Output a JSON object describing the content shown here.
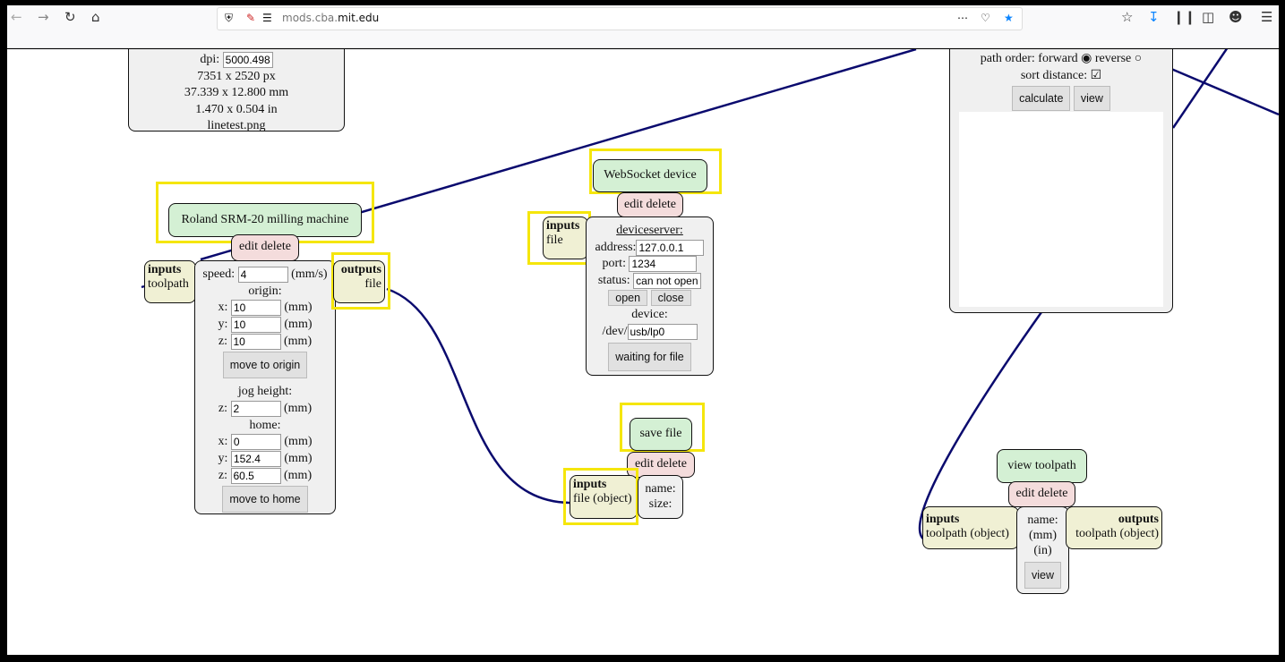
{
  "browser": {
    "url_prefix": "mods.cba.",
    "url_domain": "mit.edu",
    "icons": [
      "back-icon",
      "forward-icon",
      "reload-icon",
      "home-icon",
      "shield-icon",
      "tracking-icon",
      "permissions-icon",
      "more-icon",
      "pocket-icon",
      "bookmark-star-icon",
      "bookmarks-icon",
      "download-icon",
      "library-icon",
      "sidebar-icon",
      "account-icon",
      "menu-icon"
    ]
  },
  "colors": {
    "wire": "#0a0a6e",
    "highlight": "#f5e60c",
    "title_bg": "#d4f0d4",
    "edit_bg": "#f4dcdc",
    "io_bg": "#f0f0d4"
  },
  "image_module": {
    "dpi_label": "dpi:",
    "dpi": "5000.498",
    "px": "7351 x 2520 px",
    "mm": "37.339 x 12.800 mm",
    "in": "1.470 x 0.504 in",
    "file": "linetest.png"
  },
  "path_module": {
    "path_order": "path order: forward",
    "reverse": "reverse",
    "sort_distance": "sort distance:",
    "calculate": "calculate",
    "view": "view"
  },
  "roland": {
    "title": "Roland SRM-20 milling machine",
    "edit_delete": "edit delete",
    "inputs": "inputs",
    "inputs_type": "toolpath",
    "outputs": "outputs",
    "outputs_type": "file",
    "speed_label": "speed:",
    "speed": "4",
    "speed_unit": "(mm/s)",
    "origin_label": "origin:",
    "origin_x": "10",
    "origin_y": "10",
    "origin_z": "10",
    "unit": "(mm)",
    "move_origin": "move to origin",
    "jog_label": "jog height:",
    "jog_z": "2",
    "home_label": "home:",
    "home_x": "0",
    "home_y": "152.4",
    "home_z": "60.5",
    "move_home": "move to home",
    "x": "x:",
    "y": "y:",
    "z": "z:"
  },
  "websocket": {
    "title": "WebSocket device",
    "edit_delete": "edit delete",
    "inputs": "inputs",
    "inputs_type": "file",
    "server_label": "deviceserver:",
    "address_label": "address:",
    "address": "127.0.0.1",
    "port_label": "port:",
    "port": "1234",
    "status_label": "status:",
    "status": "can not open",
    "open": "open",
    "close": "close",
    "device_label": "device:",
    "dev_prefix": "/dev/",
    "device": "usb/lp0",
    "waiting": "waiting for file"
  },
  "save_file": {
    "title": "save file",
    "edit_delete": "edit delete",
    "inputs": "inputs",
    "inputs_type": "file (object)",
    "name": "name:",
    "size": "size:"
  },
  "view_toolpath": {
    "title": "view toolpath",
    "edit_delete": "edit delete",
    "inputs": "inputs",
    "inputs_type": "toolpath (object)",
    "outputs": "outputs",
    "outputs_type": "toolpath (object)",
    "name": "name:",
    "mm": "(mm)",
    "in": "(in)",
    "view": "view"
  }
}
